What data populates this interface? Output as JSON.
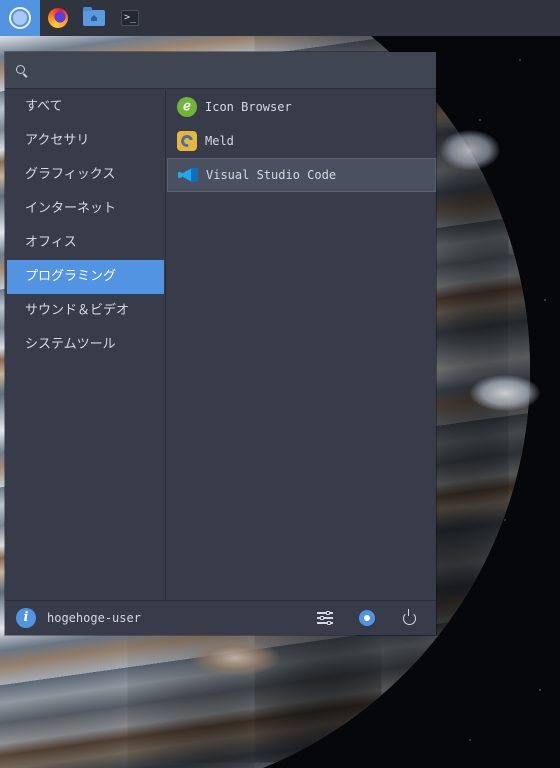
{
  "search": {
    "placeholder": "",
    "value": ""
  },
  "categories": [
    {
      "label": "すべて",
      "selected": false
    },
    {
      "label": "アクセサリ",
      "selected": false
    },
    {
      "label": "グラフィックス",
      "selected": false
    },
    {
      "label": "インターネット",
      "selected": false
    },
    {
      "label": "オフィス",
      "selected": false
    },
    {
      "label": "プログラミング",
      "selected": true
    },
    {
      "label": "サウンド＆ビデオ",
      "selected": false
    },
    {
      "label": "システムツール",
      "selected": false
    }
  ],
  "apps": [
    {
      "label": "Icon Browser",
      "icon": "icon-browser-icon",
      "selected": false
    },
    {
      "label": "Meld",
      "icon": "meld-icon",
      "selected": false
    },
    {
      "label": "Visual Studio Code",
      "icon": "vscode-icon",
      "selected": true
    }
  ],
  "user": {
    "name": "hogehoge-user"
  },
  "taskbar": {
    "items": [
      "whisker-menu-icon",
      "firefox-icon",
      "file-manager-icon",
      "terminal-icon"
    ],
    "active": "whisker-menu-icon"
  },
  "colors": {
    "accent": "#5294e2",
    "panel": "#2f343f",
    "menu_bg": "#383c4a"
  }
}
